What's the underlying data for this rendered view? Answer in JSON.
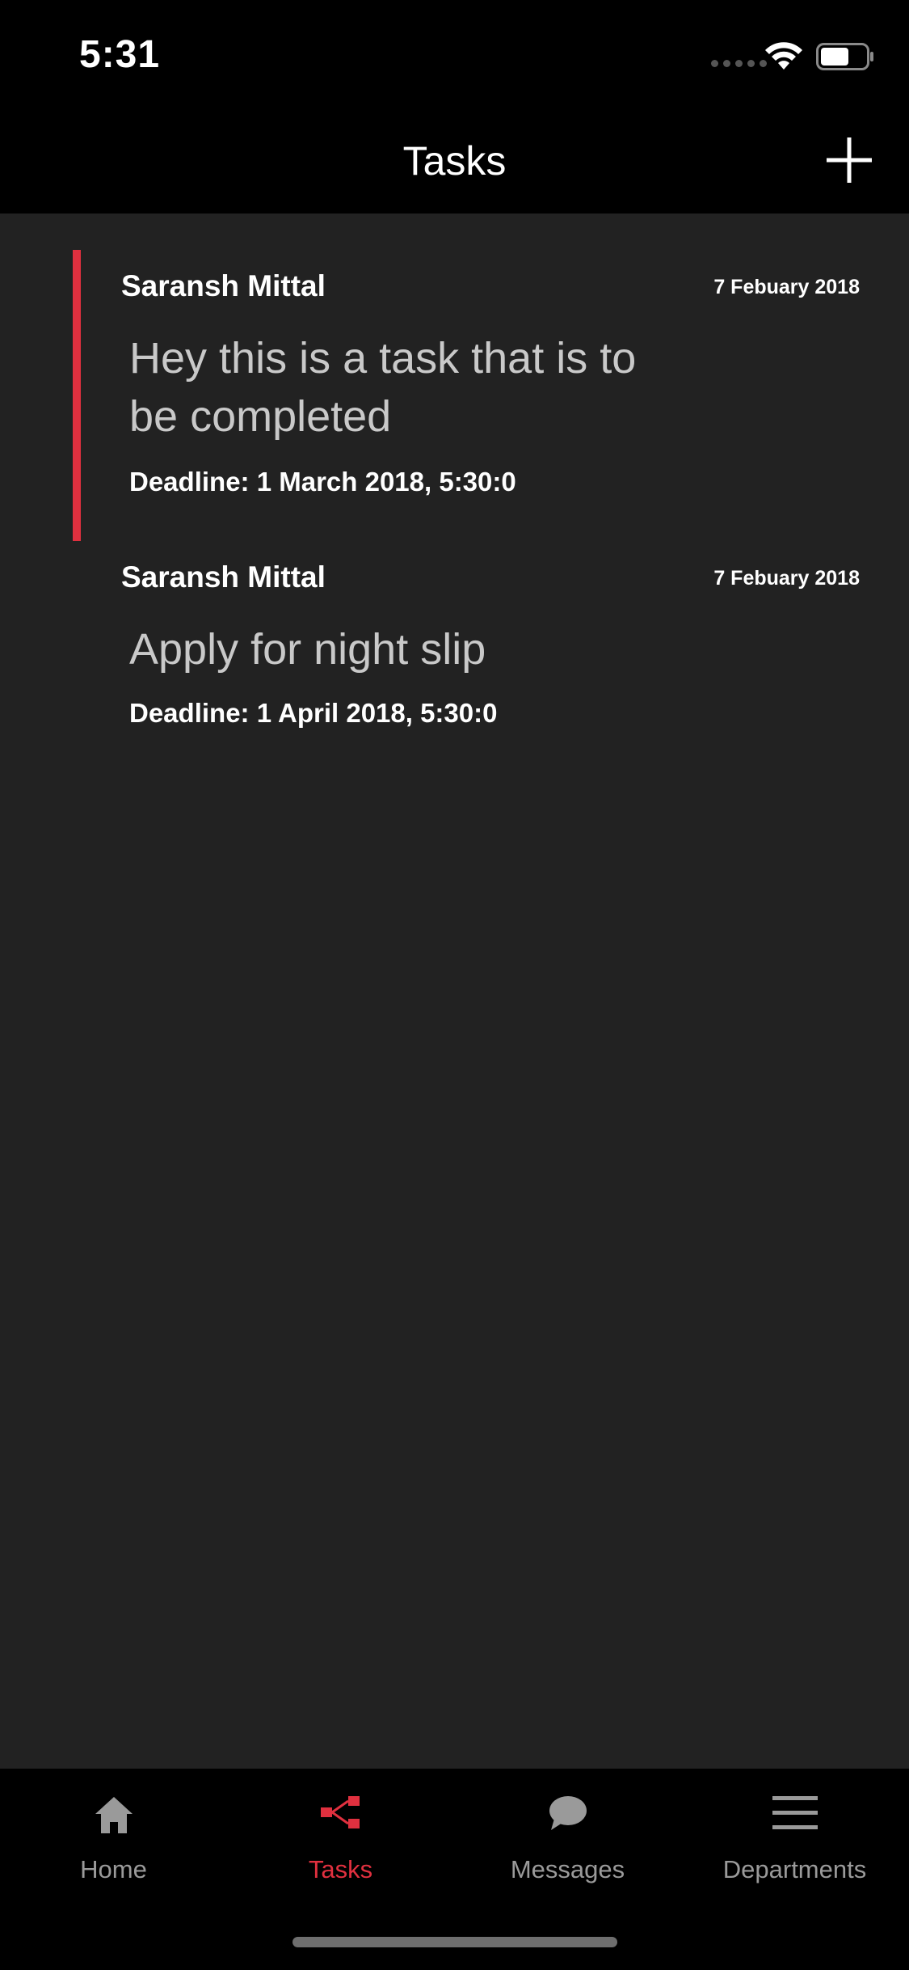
{
  "status_bar": {
    "time": "5:31"
  },
  "nav": {
    "title": "Tasks",
    "add_icon": "plus-icon"
  },
  "tasks": [
    {
      "author": "Saransh Mittal",
      "date": "7 Febuary 2018",
      "text": "Hey this is a task that is to be completed",
      "deadline": "Deadline: 1 March 2018, 5:30:0",
      "selected": true
    },
    {
      "author": "Saransh Mittal",
      "date": "7 Febuary 2018",
      "text": "Apply for night slip",
      "deadline": "Deadline: 1 April 2018, 5:30:0",
      "selected": false
    }
  ],
  "tab_bar": {
    "tabs": [
      {
        "label": "Home",
        "icon": "home-icon",
        "active": false
      },
      {
        "label": "Tasks",
        "icon": "tasks-icon",
        "active": true
      },
      {
        "label": "Messages",
        "icon": "chat-bubble-icon",
        "active": false
      },
      {
        "label": "Departments",
        "icon": "menu-lines-icon",
        "active": false
      }
    ]
  },
  "colors": {
    "accent": "#e0303f",
    "background": "#222222",
    "bars": "#000000",
    "inactive_tab": "#9a9a9a"
  }
}
